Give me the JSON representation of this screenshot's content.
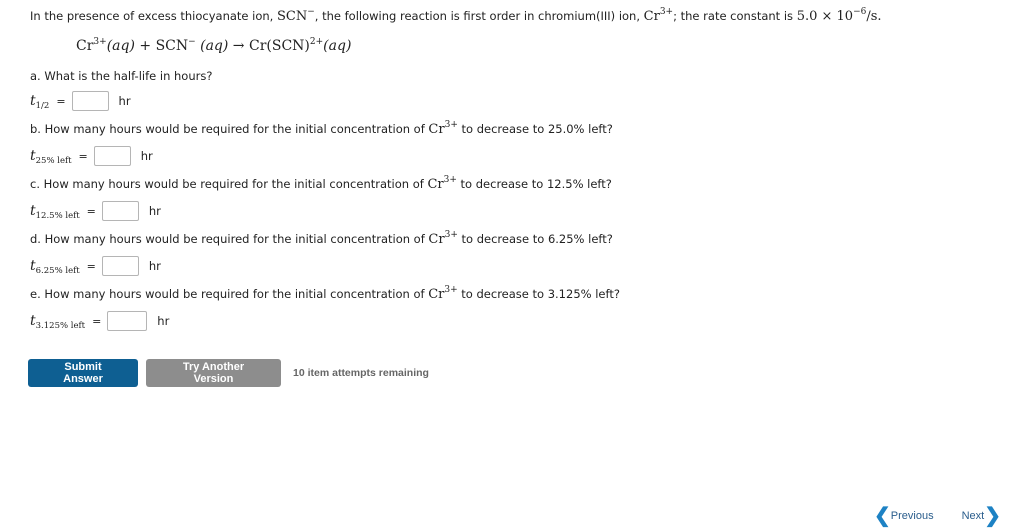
{
  "problem": {
    "intro_part1": "In the presence of excess thiocyanate ion, ",
    "scn_ion": "SCN",
    "scn_charge": "−",
    "intro_part2": ", the following reaction is first order in chromium(III) ion, ",
    "cr_ion": "Cr",
    "cr_charge": "3+",
    "intro_part3": "; the rate constant is ",
    "rate_constant_mantissa": "5.0 × 10",
    "rate_constant_exponent": "−6",
    "rate_constant_unit": "/s."
  },
  "equation": {
    "reactant1": "Cr",
    "reactant1_charge": "3+",
    "reactant1_state": "(aq)",
    "plus": " + ",
    "reactant2": "SCN",
    "reactant2_charge": "−",
    "reactant2_state": "(aq)",
    "arrow": " → ",
    "product": "Cr(SCN)",
    "product_charge": "2+",
    "product_state": "(aq)"
  },
  "questions": [
    {
      "label": "a. What is the half-life in hours?",
      "var": "t",
      "sub": "1/2",
      "value": "",
      "unit": "hr"
    },
    {
      "label_before": "b. How many hours would be required for the initial concentration of ",
      "ion": "Cr",
      "charge": "3+",
      "label_after": " to decrease to 25.0% left?",
      "var": "t",
      "sub": "25% left",
      "value": "",
      "unit": "hr"
    },
    {
      "label_before": "c. How many hours would be required for the initial concentration of ",
      "ion": "Cr",
      "charge": "3+",
      "label_after": " to decrease to 12.5% left?",
      "var": "t",
      "sub": "12.5% left",
      "value": "",
      "unit": "hr"
    },
    {
      "label_before": "d. How many hours would be required for the initial concentration of ",
      "ion": "Cr",
      "charge": "3+",
      "label_after": " to decrease to 6.25% left?",
      "var": "t",
      "sub": "6.25% left",
      "value": "",
      "unit": "hr"
    },
    {
      "label_before": "e. How many hours would be required for the initial concentration of ",
      "ion": "Cr",
      "charge": "3+",
      "label_after": " to decrease to 3.125% left?",
      "var": "t",
      "sub": "3.125% left",
      "value": "",
      "unit": "hr"
    }
  ],
  "equals": "=",
  "actions": {
    "submit_label": "Submit Answer",
    "try_another_label": "Try Another Version",
    "attempts_text": "10 item attempts remaining"
  },
  "nav": {
    "previous_label": "Previous",
    "next_label": "Next",
    "previous_icon": "chevron-left-icon",
    "next_icon": "chevron-right-icon"
  },
  "colors": {
    "submit_bg": "#0e5f92",
    "try_another_bg": "#8d8d8d",
    "nav_chevron": "#1d82c4"
  }
}
